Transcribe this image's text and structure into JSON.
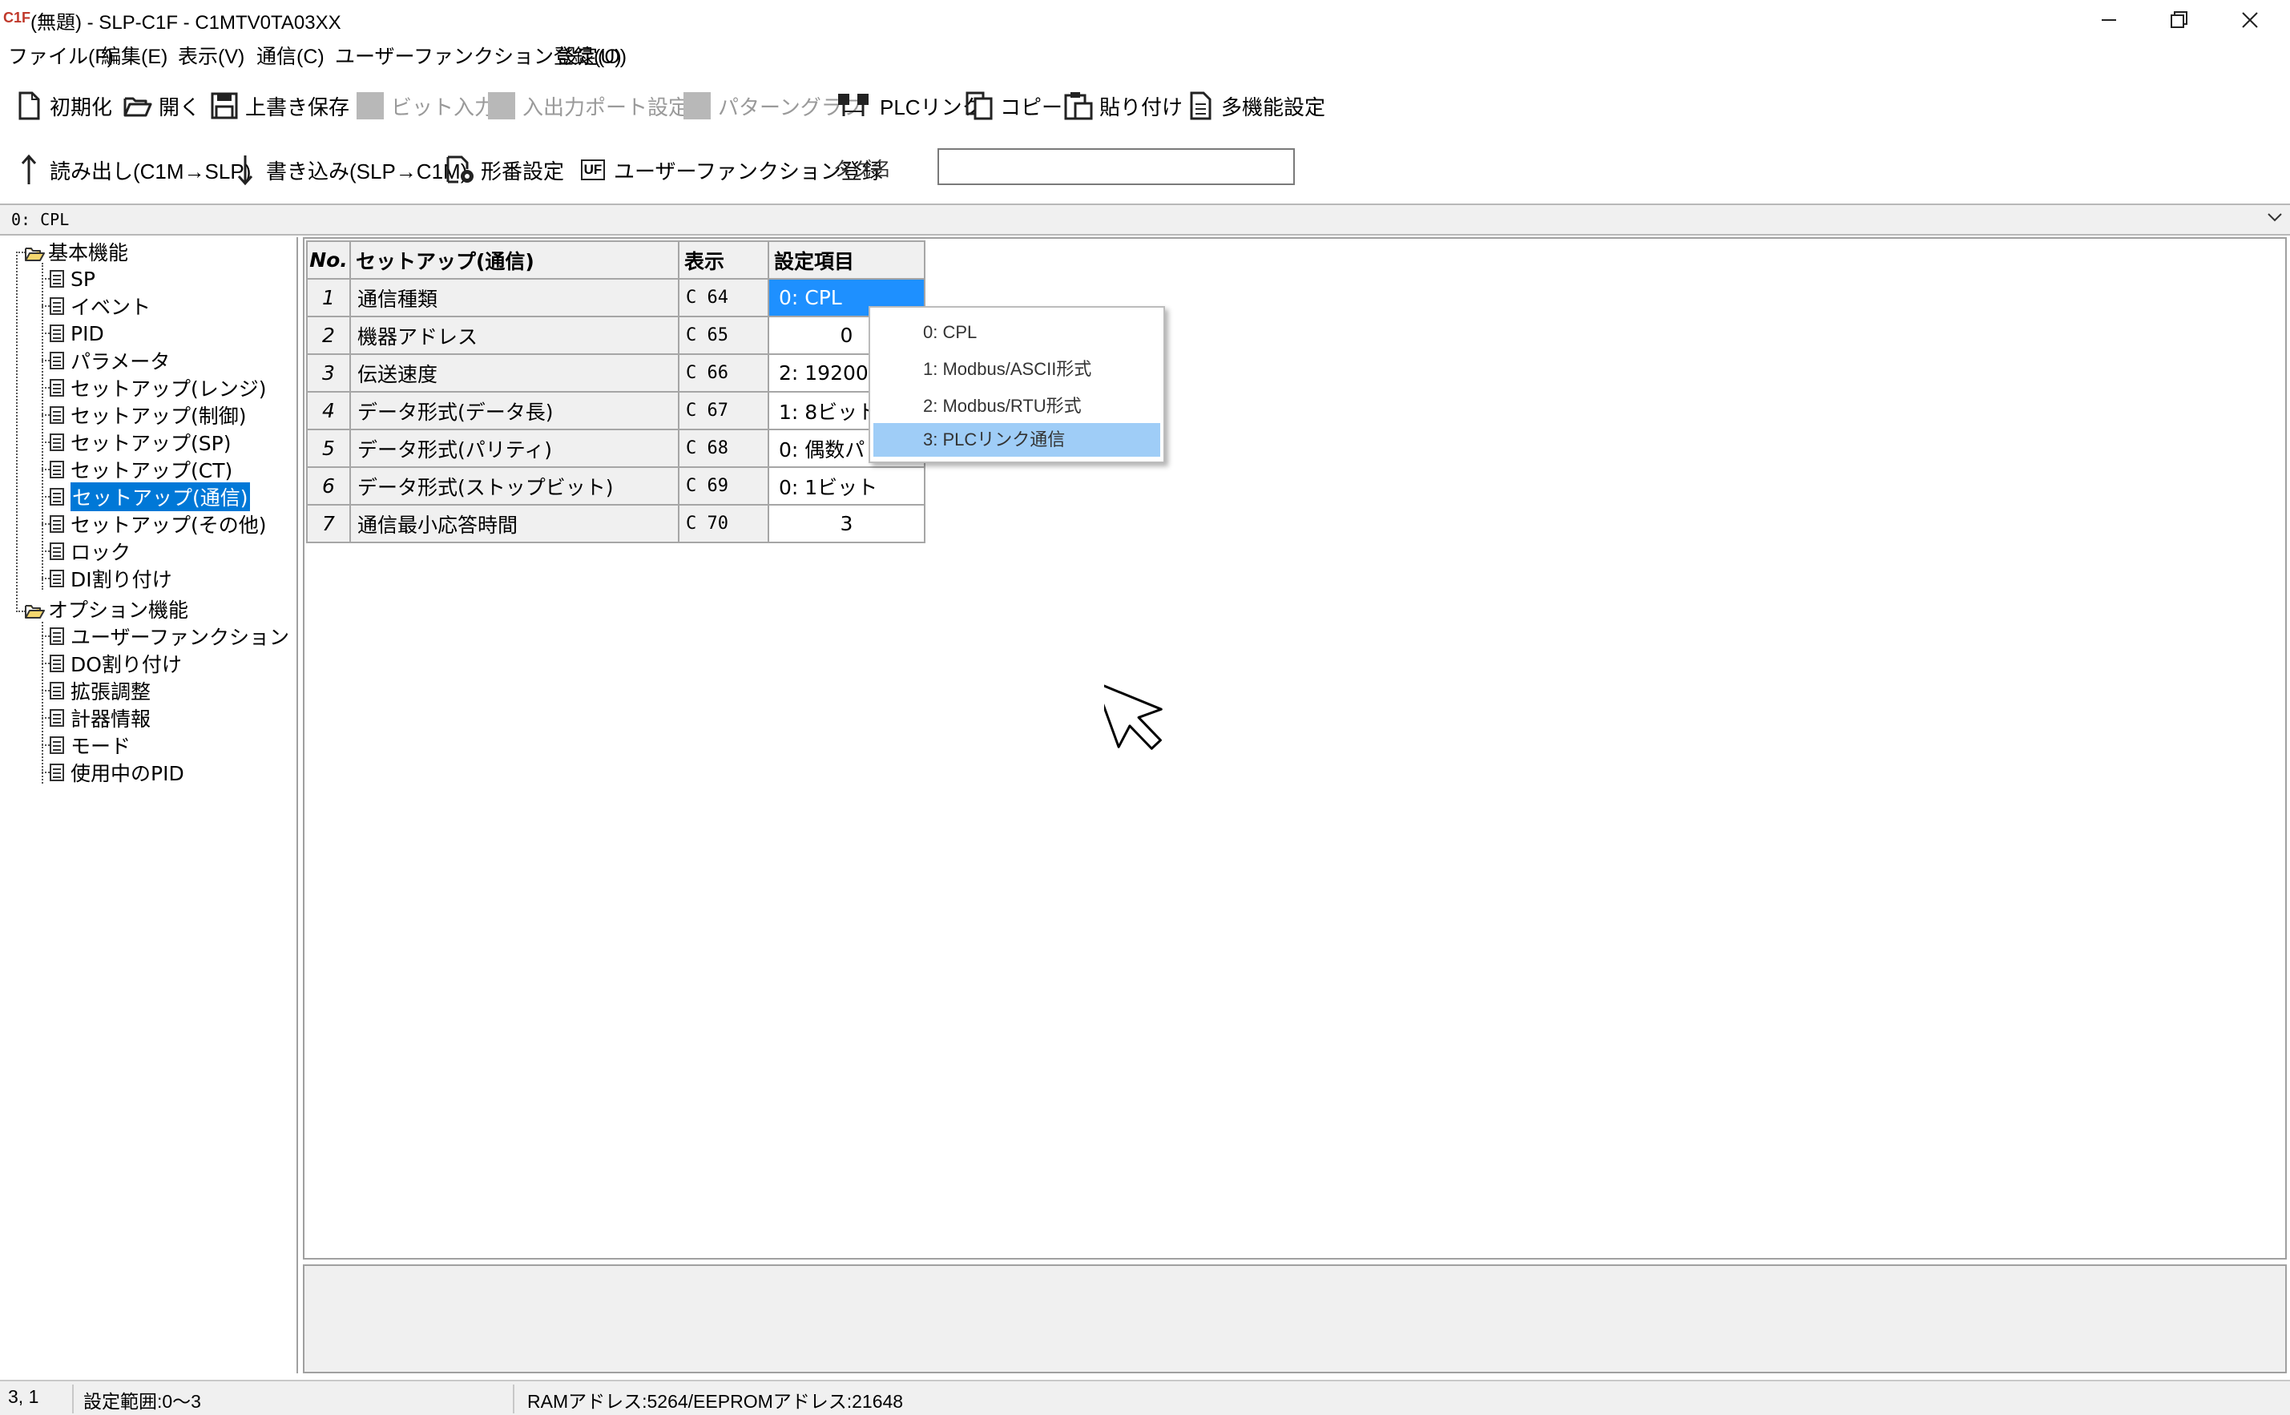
{
  "window": {
    "logo": "C1F",
    "title": "(無題) - SLP-C1F - C1MTV0TA03XX"
  },
  "menu": [
    "ファイル(F)",
    "編集(E)",
    "表示(V)",
    "通信(C)",
    "ユーザーファンクション登録(U)",
    "設定(O)"
  ],
  "toolbar1": {
    "init": "初期化",
    "open": "開く",
    "save": "上書き保存",
    "bit_input": "ビット入力",
    "io_port": "入出力ポート設定",
    "pattern_graph": "パターングラフ",
    "plc_link": "PLCリンク",
    "copy": "コピー",
    "paste": "貼り付け",
    "multi": "多機能設定"
  },
  "toolbar2": {
    "read": "読み出し(C1M→SLP)",
    "write": "書き込み(SLP→C1M)",
    "model": "形番設定",
    "uf_icon": "UF",
    "uf_register": "ユーザーファンクション登録",
    "tag_label": "タグ名",
    "tag_value": ""
  },
  "combo": {
    "value": "0: CPL"
  },
  "tree": {
    "basic": "基本機能",
    "basic_items": [
      "SP",
      "イベント",
      "PID",
      "パラメータ",
      "セットアップ(レンジ)",
      "セットアップ(制御)",
      "セットアップ(SP)",
      "セットアップ(CT)",
      "セットアップ(通信)",
      "セットアップ(その他)",
      "ロック",
      "DI割り付け"
    ],
    "option": "オプション機能",
    "option_items": [
      "ユーザーファンクション",
      "DO割り付け",
      "拡張調整",
      "計器情報",
      "モード",
      "使用中のPID"
    ],
    "selected": "セットアップ(通信)"
  },
  "grid": {
    "headers": {
      "no": "No.",
      "name": "セットアップ(通信)",
      "disp": "表示",
      "val": "設定項目"
    },
    "rows": [
      {
        "no": "1",
        "name": "通信種類",
        "disp": "C 64",
        "val": "0: CPL"
      },
      {
        "no": "2",
        "name": "機器アドレス",
        "disp": "C 65",
        "val": "0"
      },
      {
        "no": "3",
        "name": "伝送速度",
        "disp": "C 66",
        "val": "2: 19200bps"
      },
      {
        "no": "4",
        "name": "データ形式(データ長)",
        "disp": "C 67",
        "val": "1: 8ビット"
      },
      {
        "no": "5",
        "name": "データ形式(パリティ)",
        "disp": "C 68",
        "val": "0: 偶数パリティ"
      },
      {
        "no": "6",
        "name": "データ形式(ストップビット)",
        "disp": "C 69",
        "val": "0: 1ビット"
      },
      {
        "no": "7",
        "name": "通信最小応答時間",
        "disp": "C 70",
        "val": "3"
      }
    ]
  },
  "dropdown": {
    "options": [
      "0: CPL",
      "1: Modbus/ASCII形式",
      "2: Modbus/RTU形式",
      "3: PLCリンク通信"
    ],
    "highlighted": "3: PLCリンク通信"
  },
  "status": {
    "pos": "3, 1",
    "range": "設定範囲:0〜3",
    "address": "RAMアドレス:5264/EEPROMアドレス:21648"
  }
}
